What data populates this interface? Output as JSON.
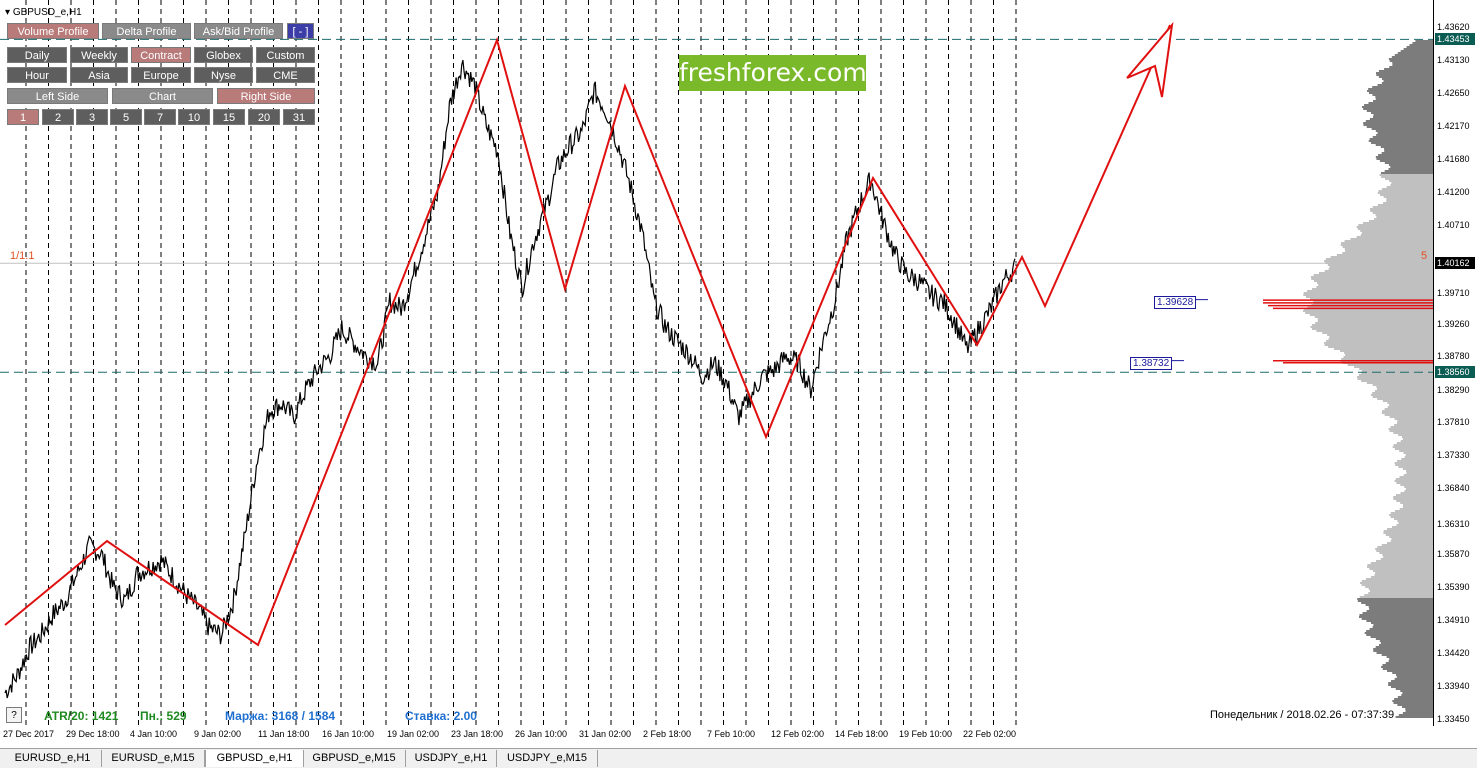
{
  "window": {
    "symbol": "GBPUSD_e,H1"
  },
  "toolbar": {
    "row1": [
      {
        "label": "Volume Profile",
        "style": "rose"
      },
      {
        "label": "Delta Profile",
        "style": "grey"
      },
      {
        "label": "Ask/Bid Profile",
        "style": "grey"
      },
      {
        "label": "[ - ]",
        "style": "blue"
      }
    ],
    "row2": [
      {
        "label": "Daily",
        "style": "dark"
      },
      {
        "label": "Weekly",
        "style": "dark"
      },
      {
        "label": "Contract",
        "style": "rose"
      },
      {
        "label": "Globex",
        "style": "dark"
      },
      {
        "label": "Custom",
        "style": "dark"
      }
    ],
    "row3": [
      {
        "label": "Hour",
        "style": "dark"
      },
      {
        "label": "Asia",
        "style": "dark"
      },
      {
        "label": "Europe",
        "style": "dark"
      },
      {
        "label": "Nyse",
        "style": "dark"
      },
      {
        "label": "CME",
        "style": "dark"
      }
    ],
    "row4": [
      {
        "label": "Left Side",
        "style": "grey"
      },
      {
        "label": "Chart",
        "style": "grey"
      },
      {
        "label": "Right Side",
        "style": "rose"
      }
    ],
    "row5": [
      {
        "label": "1",
        "style": "rose"
      },
      {
        "label": "2",
        "style": "dark"
      },
      {
        "label": "3",
        "style": "dark"
      },
      {
        "label": "5",
        "style": "dark"
      },
      {
        "label": "7",
        "style": "dark"
      },
      {
        "label": "10",
        "style": "dark"
      },
      {
        "label": "15",
        "style": "dark"
      },
      {
        "label": "20",
        "style": "dark"
      },
      {
        "label": "31",
        "style": "dark"
      }
    ]
  },
  "brand": {
    "text": "freshforex.com",
    "color": "#7ab929"
  },
  "labels": {
    "ratio": "1/1.1",
    "count": "5",
    "question": "?"
  },
  "stats": {
    "atr": "ATR/20: 1421",
    "pn": "Пн.: 529",
    "margin": "Маржа: 3168 / 1584",
    "rate": "Ставка: 2.00"
  },
  "footer": {
    "datetime": "Понедельник  /  2018.02.26  -  07:37:39"
  },
  "tabs": [
    "EURUSD_e,H1",
    "EURUSD_e,M15",
    "GBPUSD_e,H1",
    "GBPUSD_e,M15",
    "USDJPY_e,H1",
    "USDJPY_e,M15"
  ],
  "active_tab": 2,
  "levels": {
    "box1": "1.39628",
    "box2": "1.38732"
  },
  "colors": {
    "zigzag": "#e01010",
    "level_line": "#1a6b6b",
    "tag_green": "#0b5c52",
    "tag_black": "#000000",
    "profile_dark": "#7c7c7c",
    "profile_light": "#c0c0c0",
    "poc": "#e01010"
  },
  "chart_data": {
    "type": "line",
    "symbol": "GBPUSD_e,H1",
    "y_ticks": [
      "1.43620",
      "1.43130",
      "1.42650",
      "1.42170",
      "1.41680",
      "1.41200",
      "1.40710",
      "1.39710",
      "1.39260",
      "1.38780",
      "1.38290",
      "1.37810",
      "1.37330",
      "1.36840",
      "1.36310",
      "1.35870",
      "1.35390",
      "1.34910",
      "1.34420",
      "1.33940",
      "1.33450"
    ],
    "price_tags": [
      {
        "value": "1.43453",
        "color": "#0b5c52"
      },
      {
        "value": "1.40162",
        "color": "#000000"
      },
      {
        "value": "1.38560",
        "color": "#0b5c52"
      }
    ],
    "x_ticks": [
      "27 Dec 2017",
      "29 Dec 18:00",
      "4 Jan 10:00",
      "9 Jan 02:00",
      "11 Jan 18:00",
      "16 Jan 10:00",
      "19 Jan 02:00",
      "23 Jan 18:00",
      "26 Jan 10:00",
      "31 Jan 02:00",
      "2 Feb 18:00",
      "7 Feb 10:00",
      "12 Feb 02:00",
      "14 Feb 18:00",
      "19 Feb 10:00",
      "22 Feb 02:00"
    ],
    "horizontal_levels": [
      1.43453,
      1.3856
    ],
    "current_price": 1.40162,
    "zigzag": [
      {
        "x": "27 Dec 2017",
        "y": 1.349
      },
      {
        "x": "29 Dec 18:00",
        "y": 1.361
      },
      {
        "x": "9 Jan 02:00",
        "y": 1.3458
      },
      {
        "x": "24 Jan 10:00",
        "y": 1.4345
      },
      {
        "x": "26 Jan 10:00",
        "y": 1.398
      },
      {
        "x": "31 Jan 10:00",
        "y": 1.4275
      },
      {
        "x": "9 Feb 10:00",
        "y": 1.377
      },
      {
        "x": "15 Feb 10:00",
        "y": 1.4145
      },
      {
        "x": "22 Feb 02:00",
        "y": 1.3856
      },
      {
        "x": "23 Feb 10:00",
        "y": 1.403
      },
      {
        "x": "24 Feb 02:00",
        "y": 1.395
      },
      {
        "x": "forecast",
        "y": 1.436
      }
    ],
    "price_path": [
      [
        1.3385,
        1.341,
        1.345,
        1.347,
        1.35,
        1.352,
        1.356,
        1.36,
        1.359,
        1.354,
        1.352,
        1.356,
        1.357,
        1.358,
        1.3555,
        1.353,
        1.351,
        1.348,
        1.347,
        1.352,
        1.362,
        1.373,
        1.38,
        1.381,
        1.379,
        1.383,
        1.386,
        1.388,
        1.392,
        1.39,
        1.388,
        1.387,
        1.396,
        1.395,
        1.4,
        1.406,
        1.412,
        1.425,
        1.431,
        1.428,
        1.422,
        1.418,
        1.406,
        1.398,
        1.405,
        1.41,
        1.416,
        1.419,
        1.421,
        1.427,
        1.424,
        1.419,
        1.413,
        1.406,
        1.396,
        1.392,
        1.39,
        1.388,
        1.385,
        1.387,
        1.384,
        1.379,
        1.382,
        1.385,
        1.386,
        1.388,
        1.387,
        1.383,
        1.39,
        1.396,
        1.405,
        1.41,
        1.414,
        1.408,
        1.403,
        1.4,
        1.399,
        1.397,
        1.396,
        1.393,
        1.389,
        1.392,
        1.395,
        1.399,
        1.401
      ]
    ],
    "volume_profile": "right-side histogram; point of control near 1.3962 and 1.3873"
  }
}
